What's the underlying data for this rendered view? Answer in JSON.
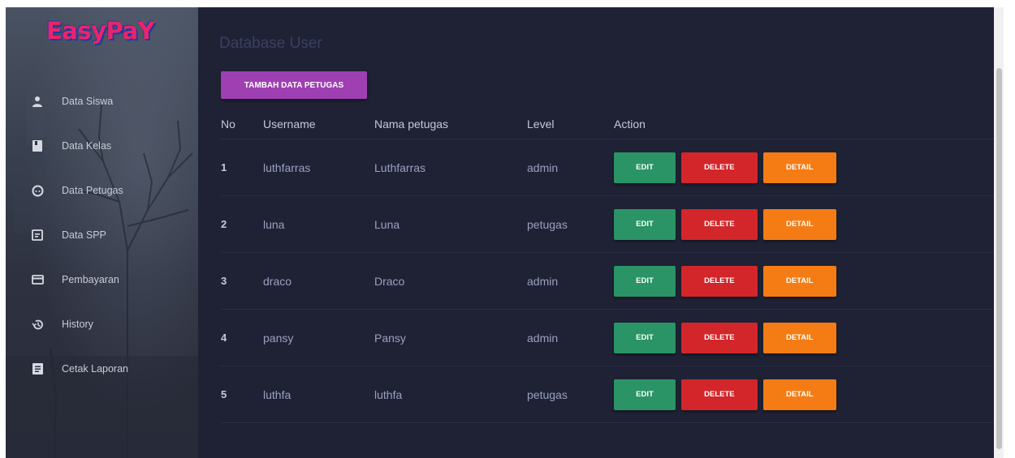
{
  "app": {
    "logo_text": "EasyPaY"
  },
  "sidebar": {
    "items": [
      {
        "label": "Data Siswa",
        "icon": "person-icon"
      },
      {
        "label": "Data Kelas",
        "icon": "book-icon"
      },
      {
        "label": "Data Petugas",
        "icon": "face-icon"
      },
      {
        "label": "Data SPP",
        "icon": "receipt-icon"
      },
      {
        "label": "Pembayaran",
        "icon": "credit-card-icon"
      },
      {
        "label": "History",
        "icon": "history-icon"
      },
      {
        "label": "Cetak Laporan",
        "icon": "report-icon"
      }
    ]
  },
  "main": {
    "title": "Database User",
    "add_button_label": "TAMBAH DATA PETUGAS",
    "table": {
      "headers": [
        "No",
        "Username",
        "Nama petugas",
        "Level",
        "Action"
      ],
      "rows": [
        {
          "no": "1",
          "username": "luthfarras",
          "nama": "Luthfarras",
          "level": "admin"
        },
        {
          "no": "2",
          "username": "luna",
          "nama": "Luna",
          "level": "petugas"
        },
        {
          "no": "3",
          "username": "draco",
          "nama": "Draco",
          "level": "admin"
        },
        {
          "no": "4",
          "username": "pansy",
          "nama": "Pansy",
          "level": "admin"
        },
        {
          "no": "5",
          "username": "luthfa",
          "nama": "luthfa",
          "level": "petugas"
        }
      ],
      "action_labels": {
        "edit": "EDIT",
        "delete": "DELETE",
        "detail": "DETAIL"
      }
    }
  },
  "colors": {
    "background": "#1f2235",
    "accent_purple": "#9e3fb2",
    "edit_green": "#2a9466",
    "delete_red": "#d3262a",
    "detail_orange": "#f57c14"
  }
}
